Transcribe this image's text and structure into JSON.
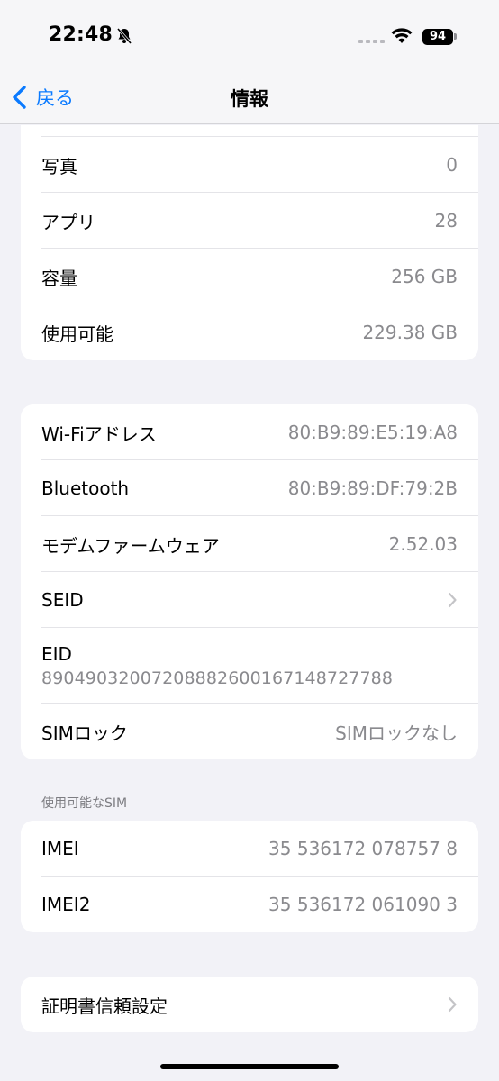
{
  "status": {
    "time": "22:48",
    "battery": "94"
  },
  "nav": {
    "back_label": "戻る",
    "title": "情報"
  },
  "group1": {
    "rows": [
      {
        "label": "写真",
        "value": "0"
      },
      {
        "label": "アプリ",
        "value": "28"
      },
      {
        "label": "容量",
        "value": "256 GB"
      },
      {
        "label": "使用可能",
        "value": "229.38 GB"
      }
    ]
  },
  "group2": {
    "wifi": {
      "label": "Wi-Fiアドレス",
      "value": "80:B9:89:E5:19:A8"
    },
    "bluetooth": {
      "label": "Bluetooth",
      "value": "80:B9:89:DF:79:2B"
    },
    "modem": {
      "label": "モデムファームウェア",
      "value": "2.52.03"
    },
    "seid": {
      "label": "SEID"
    },
    "eid": {
      "label": "EID",
      "value": "89049032007208882600167148727788"
    },
    "sim_lock": {
      "label": "SIMロック",
      "value": "SIMロックなし"
    }
  },
  "sim_section": {
    "header": "使用可能なSIM",
    "imei": {
      "label": "IMEI",
      "value": "35 536172 078757 8"
    },
    "imei2": {
      "label": "IMEI2",
      "value": "35 536172 061090 3"
    }
  },
  "cert": {
    "label": "証明書信頼設定"
  }
}
